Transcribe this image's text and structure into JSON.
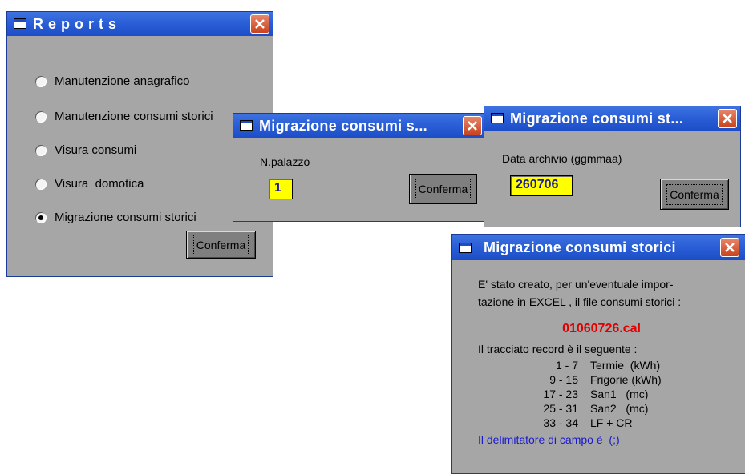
{
  "reports": {
    "title": "Reports",
    "options": [
      {
        "label": "Manutenzione anagrafico",
        "selected": false
      },
      {
        "label": "Manutenzione consumi storici",
        "selected": false
      },
      {
        "label": "Visura consumi",
        "selected": false
      },
      {
        "label": "Visura  domotica",
        "selected": false
      },
      {
        "label": "Migrazione consumi storici",
        "selected": true
      }
    ],
    "confirm_label": "Conferma"
  },
  "palazzo_dialog": {
    "title": "Migrazione consumi s...",
    "field_label": "N.palazzo",
    "field_value": "1",
    "confirm_label": "Conferma"
  },
  "data_dialog": {
    "title": "Migrazione consumi st...",
    "field_label": "Data archivio (ggmmaa)",
    "field_value": "260706",
    "confirm_label": "Conferma"
  },
  "result_dialog": {
    "title": "Migrazione consumi storici",
    "message_line1": "E' stato creato, per un'eventuale impor-",
    "message_line2": "tazione in EXCEL ,  il file consumi storici :",
    "filename": "01060726.cal",
    "record_intro": "Il tracciato record è il seguente :",
    "records": [
      {
        "range": "1 - 7",
        "field": "Termie  (kWh)"
      },
      {
        "range": "9 - 15",
        "field": "Frigorie (kWh)"
      },
      {
        "range": "17 - 23",
        "field": "San1   (mc)"
      },
      {
        "range": "25 - 31",
        "field": "San2   (mc)"
      },
      {
        "range": "33 - 34",
        "field": "LF + CR"
      }
    ],
    "delimiter_note": "Il delimitatore di campo è  (;)"
  },
  "colors": {
    "titlebar": "#2a5fd8",
    "field_bg": "#ffff00",
    "filename": "#e00000",
    "note": "#1a1ad0"
  },
  "icons": {
    "window": "window-icon",
    "close": "close-icon"
  }
}
